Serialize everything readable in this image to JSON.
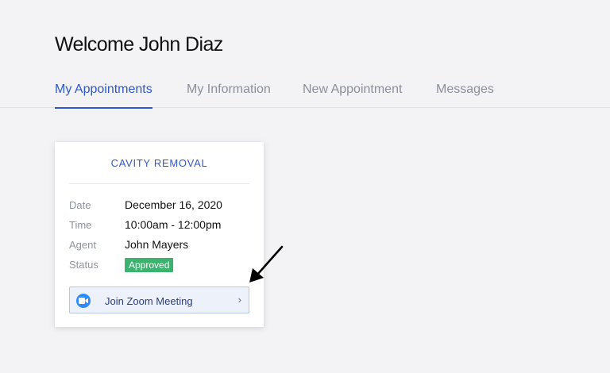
{
  "header": {
    "welcome": "Welcome John Diaz"
  },
  "tabs": [
    {
      "label": "My Appointments",
      "active": true
    },
    {
      "label": "My Information",
      "active": false
    },
    {
      "label": "New Appointment",
      "active": false
    },
    {
      "label": "Messages",
      "active": false
    }
  ],
  "appointment": {
    "title": "CAVITY REMOVAL",
    "fields": [
      {
        "label": "Date",
        "value": "December 16, 2020"
      },
      {
        "label": "Time",
        "value": "10:00am - 12:00pm"
      },
      {
        "label": "Agent",
        "value": "John Mayers"
      },
      {
        "label": "Status",
        "value": "Approved"
      }
    ],
    "join_button": {
      "label": "Join Zoom Meeting",
      "icon": "zoom-camera-icon",
      "chevron": "›"
    }
  },
  "colors": {
    "accent": "#3058c9",
    "status_approved": "#3bb36e",
    "zoom_blue": "#2d8cff",
    "background": "#f3f3f5"
  },
  "annotation": {
    "icon": "pointer-arrow-icon"
  }
}
